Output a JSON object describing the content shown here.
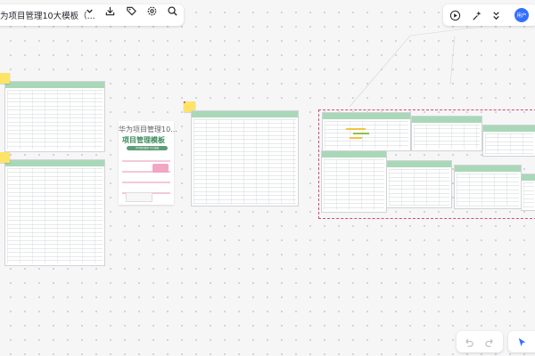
{
  "document": {
    "title": "为项目管理10大模板（...",
    "avatar_text": "用户"
  },
  "icons": {
    "title_dropdown": "chevron-down-icon",
    "download": "download-icon",
    "tag": "tag-icon",
    "settings": "gear-icon",
    "search": "search-icon",
    "present": "play-icon",
    "magic": "sparkle-icon",
    "collapse": "double-chevron-icon",
    "undo": "undo-icon",
    "redo": "redo-icon",
    "pointer": "cursor-icon"
  },
  "board": {
    "card_label": "华为项目管理10...",
    "card_title": "项目管理模板",
    "card_subtitle": "华为项目管理 10大模板"
  },
  "colors": {
    "accent": "#3370ff",
    "template_header": "#a9d8b8",
    "frame_border": "#d14a77",
    "sticky": "#fde466"
  }
}
